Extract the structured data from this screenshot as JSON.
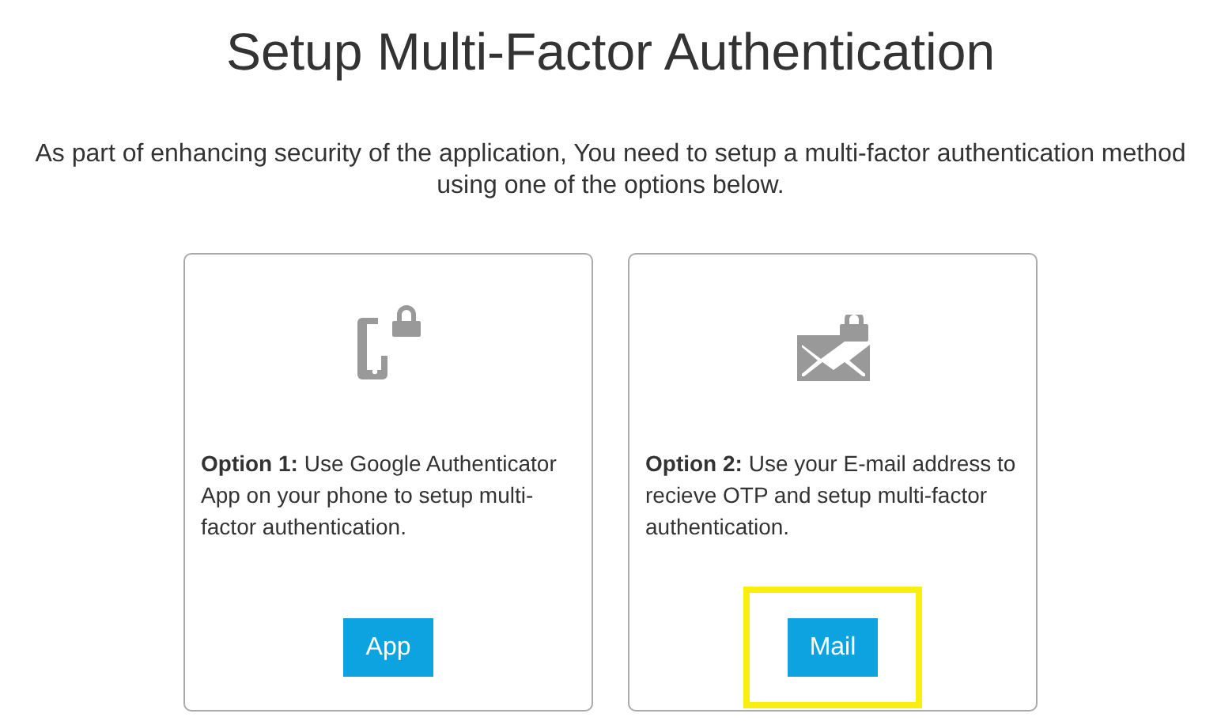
{
  "title": "Setup Multi-Factor Authentication",
  "intro": "As part of enhancing security of the application, You need to setup a multi-factor authentication method using one of the options below.",
  "options": [
    {
      "kind": "phone",
      "text": "**Option 1:** Use Google Authenticator App on your phone to setup multi-factor authentication.",
      "button": "App",
      "highlighted": false
    },
    {
      "kind": "mail",
      "text": "**Option 2:** Use your E-mail address to recieve OTP and setup multi-factor authentication.",
      "button": "Mail",
      "highlighted": true
    }
  ]
}
